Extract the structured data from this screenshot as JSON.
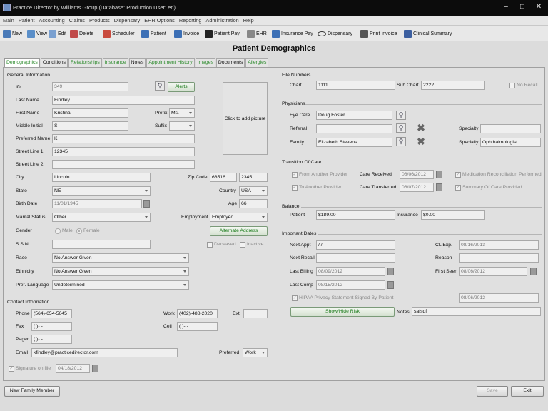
{
  "window": {
    "title": "Practice Director by Williams Group   (Database: Production   User: en)"
  },
  "menu": [
    "Main",
    "Patient",
    "Accounting",
    "Claims",
    "Products",
    "Dispensary",
    "EHR Options",
    "Reporting",
    "Administration",
    "Help"
  ],
  "toolbar": {
    "new": "New",
    "view": "View",
    "edit": "Edit",
    "delete": "Delete",
    "scheduler": "Scheduler",
    "patient": "Patient",
    "invoice": "Invoice",
    "patient_pay": "Patient Pay",
    "ehr": "EHR",
    "insurance_pay": "Insurance Pay",
    "dispensary": "Dispensary",
    "print_invoice": "Print Invoice",
    "clinical_summary": "Clinical Summary"
  },
  "page_title": "Patient Demographics",
  "tabs": [
    "Demographics",
    "Conditions",
    "Relationships",
    "Insurance",
    "Notes",
    "Appointment History",
    "Images",
    "Documents",
    "Allergies"
  ],
  "general": {
    "section": "General Information",
    "id_label": "ID",
    "id": "349",
    "alerts": "Alerts",
    "last_name_label": "Last Name",
    "last_name": "Findley",
    "first_name_label": "First Name",
    "first_name": "Kristina",
    "prefix_label": "Prefix",
    "prefix": "Ms.",
    "middle_label": "Middle Initial",
    "middle": "S",
    "suffix_label": "Suffix",
    "suffix": "",
    "preferred_label": "Preferred Name",
    "preferred": "K",
    "street1_label": "Street Line 1",
    "street1": "12345",
    "street2_label": "Street Line 2",
    "street2": "",
    "picture": "Click to add picture",
    "city_label": "City",
    "city": "Lincoln",
    "zip_label": "Zip Code",
    "zip": "68516",
    "zip4": "2345",
    "state_label": "State",
    "state": "NE",
    "country_label": "Country",
    "country": "USA",
    "birth_label": "Birth Date",
    "birth": "11/01/1945",
    "age_label": "Age",
    "age": "66",
    "marital_label": "Marital Status",
    "marital": "Other",
    "employment_label": "Employment",
    "employment": "Employed",
    "gender_label": "Gender",
    "male": "Male",
    "female": "Female",
    "alt_address": "Alternate Address",
    "ssn_label": "S.S.N.",
    "ssn": "",
    "deceased": "Deceased",
    "inactive": "Inactive",
    "race_label": "Race",
    "race": "No Answer Given",
    "ethnicity_label": "Ethnicity",
    "ethnicity": "No Answer Given",
    "language_label": "Pref. Language",
    "language": "Undetermined"
  },
  "contact": {
    "section": "Contact Information",
    "phone_label": "Phone",
    "phone": "(564)-654-5645",
    "work_label": "Work",
    "work": "(402)-488-2020",
    "ext_label": "Ext",
    "ext": "",
    "fax_label": "Fax",
    "fax": "(  )-  -",
    "cell_label": "Cell",
    "cell": "(  )-  -",
    "pager_label": "Pager",
    "pager": "(  )-  -",
    "email_label": "Email",
    "email": "kfindley@practicedirector.com",
    "preferred_label": "Preferred",
    "preferred": "Work",
    "signature_label": "Signature on file",
    "signature_date": "04/18/2012"
  },
  "file_numbers": {
    "section": "File Numbers",
    "chart_label": "Chart",
    "chart": "1111",
    "subchart_label": "Sub Chart",
    "subchart": "2222",
    "no_recall": "No Recall"
  },
  "physicians": {
    "section": "Physicians",
    "eye_label": "Eye Care",
    "eye": "Doug Foster",
    "referral_label": "Referral",
    "referral": "",
    "family_label": "Family",
    "family": "Elizabeth Stevens",
    "specialty_label": "Specialty",
    "specialty1": "",
    "specialty2": "Ophthalmologist"
  },
  "transition": {
    "section": "Transition Of Care",
    "from_provider": "From Another Provider",
    "care_received_label": "Care Received",
    "care_received": "08/06/2012",
    "med_rec": "Medication Reconciliation Performed",
    "to_provider": "To Another Provider",
    "care_transferred_label": "Care Transferred",
    "care_transferred": "08/07/2012",
    "summary": "Summary Of Care Provided"
  },
  "balance": {
    "section": "Balance",
    "patient_label": "Patient",
    "patient": "$189.00",
    "insurance_label": "Insurance",
    "insurance": "$0.00"
  },
  "dates": {
    "section": "Important Dates",
    "next_appt_label": "Next Appt",
    "next_appt": "  /  /",
    "cl_exp_label": "CL Exp.",
    "cl_exp": "08/16/2013",
    "next_recall_label": "Next Recall",
    "next_recall": "",
    "reason_label": "Reason",
    "reason": "",
    "last_billing_label": "Last Billing",
    "last_billing": "08/09/2012",
    "first_seen_label": "First Seen",
    "first_seen": "08/06/2012",
    "last_comp_label": "Last Comp",
    "last_comp": "08/15/2012",
    "hipaa": "HIPAA Privacy Statement Signed By Patient",
    "hipaa_date": "08/06/2012",
    "show_hide": "Show/Hide Risk",
    "notes_label": "Notes",
    "notes": "safsdf"
  },
  "footer": {
    "new_family": "New Family Member",
    "save": "Save",
    "exit": "Exit"
  },
  "colors": {
    "accent_green": "#2a8a2a",
    "titlebar": "#0c0c0c",
    "panel": "#e0e0e0"
  }
}
